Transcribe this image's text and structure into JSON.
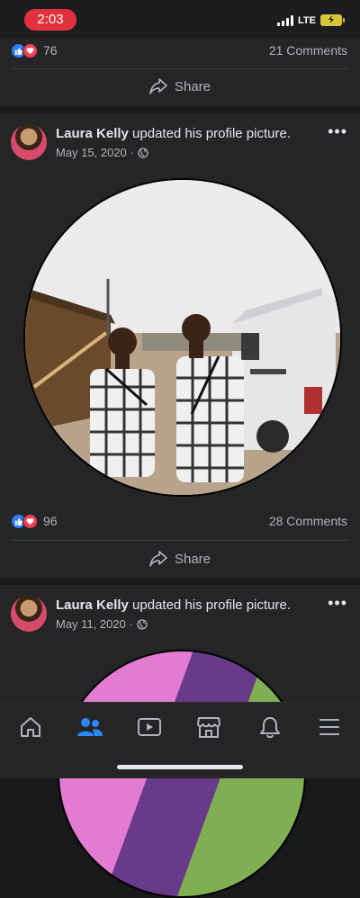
{
  "status": {
    "time": "2:03",
    "network": "LTE"
  },
  "post1_footer": {
    "reaction_count": "76",
    "comments": "21 Comments",
    "share_label": "Share"
  },
  "post2": {
    "author": "Laura Kelly",
    "action": "updated his profile picture.",
    "date": "May 15, 2020 ·",
    "reaction_count": "96",
    "comments": "28 Comments",
    "share_label": "Share"
  },
  "post3": {
    "author": "Laura Kelly",
    "action": "updated his profile picture.",
    "date": "May 11, 2020 ·"
  },
  "tabs": [
    "home-icon",
    "friends-icon",
    "watch-icon",
    "marketplace-icon",
    "notifications-icon",
    "menu-icon"
  ],
  "colors": {
    "background": "#18191a",
    "card": "#242526",
    "like_blue": "#2e7df6",
    "love_red": "#f33e58",
    "active_tab": "#2d88ff"
  }
}
